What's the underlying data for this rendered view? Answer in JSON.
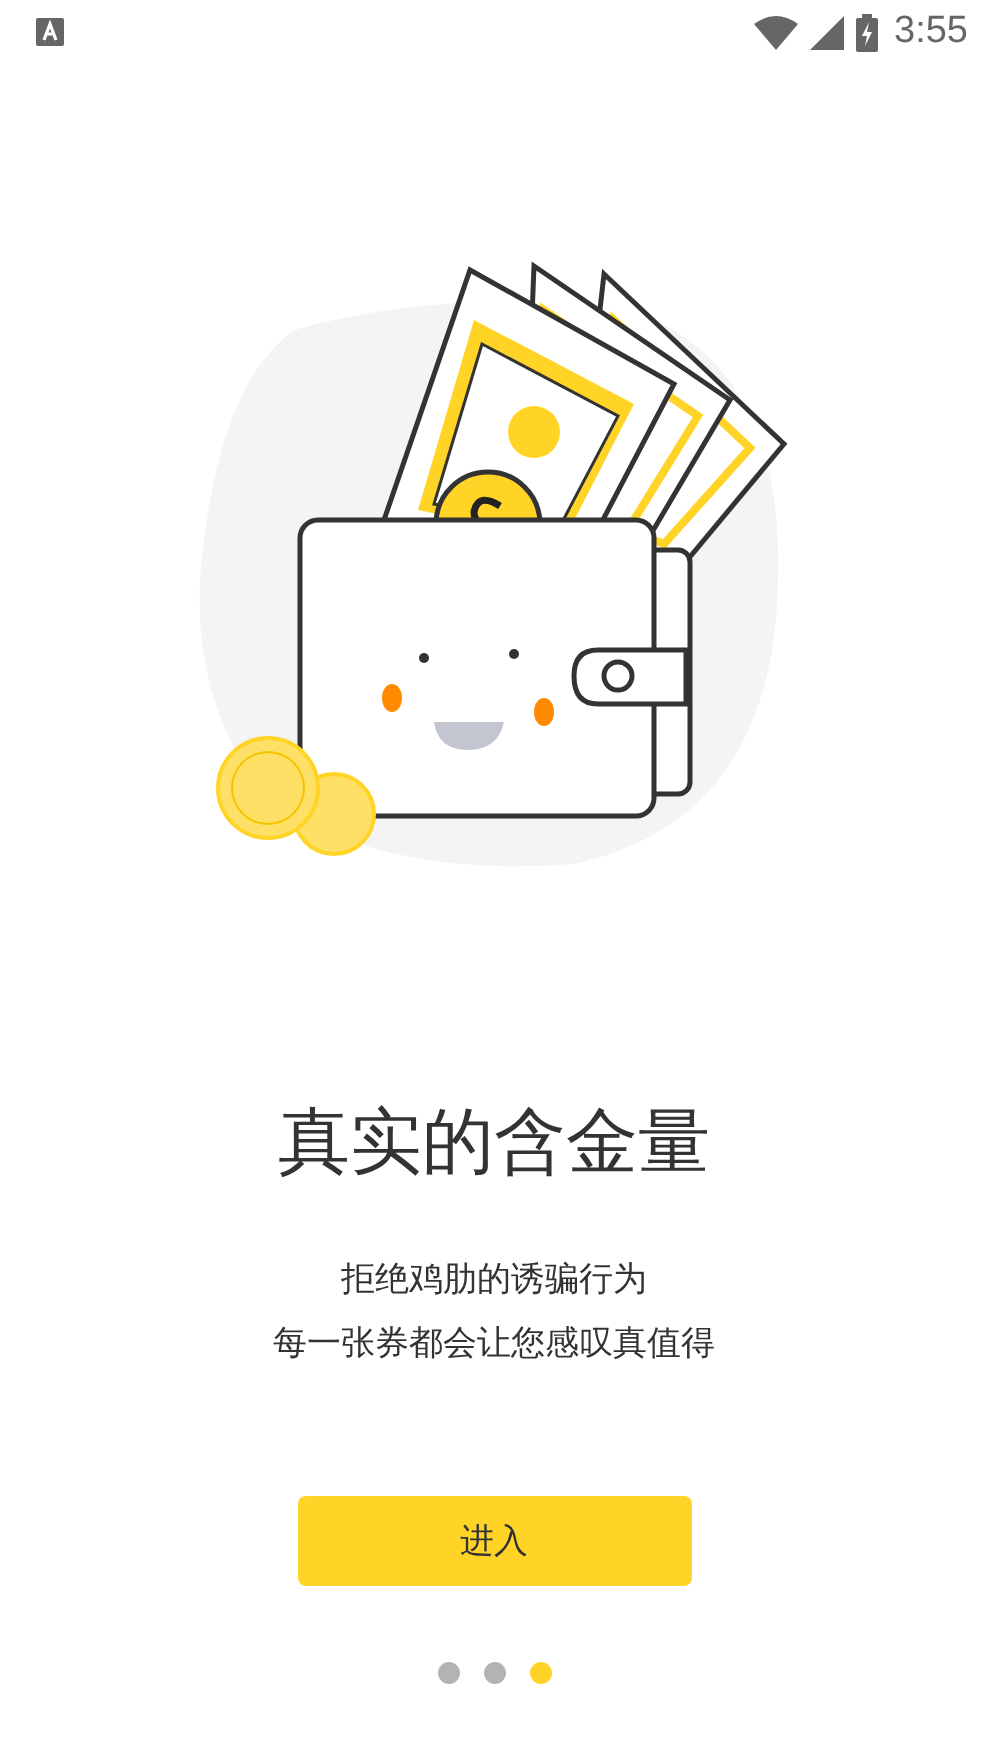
{
  "status_bar": {
    "time": "3:55"
  },
  "illustration": {
    "kind": "picture"
  },
  "title": "真实的含金量",
  "subtitle_lines": [
    "拒绝鸡肋的诱骗行为",
    "每一张券都会让您感叹真值得"
  ],
  "enter_button": {
    "label": "进入"
  },
  "page_dots": [
    {
      "selected": false
    },
    {
      "selected": false
    },
    {
      "selected": true
    }
  ]
}
